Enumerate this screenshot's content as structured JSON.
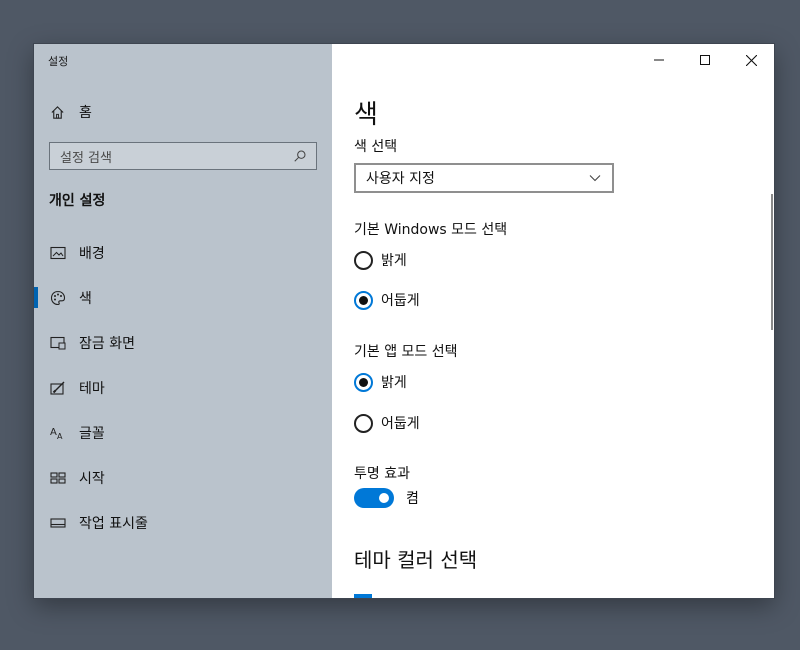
{
  "window": {
    "title": "설정"
  },
  "sidebar": {
    "home_label": "홈",
    "search_placeholder": "설정 검색",
    "section_title": "개인 설정",
    "items": [
      {
        "label": "배경",
        "icon": "picture-icon",
        "active": false
      },
      {
        "label": "색",
        "icon": "palette-icon",
        "active": true
      },
      {
        "label": "잠금 화면",
        "icon": "lock-screen-icon",
        "active": false
      },
      {
        "label": "테마",
        "icon": "theme-icon",
        "active": false
      },
      {
        "label": "글꼴",
        "icon": "font-icon",
        "active": false
      },
      {
        "label": "시작",
        "icon": "start-icon",
        "active": false
      },
      {
        "label": "작업 표시줄",
        "icon": "taskbar-icon",
        "active": false
      }
    ]
  },
  "main": {
    "page_title": "색",
    "color_select_label": "색 선택",
    "color_select_value": "사용자 지정",
    "windows_mode_label": "기본 Windows 모드 선택",
    "windows_mode_options": [
      {
        "label": "밝게",
        "selected": false
      },
      {
        "label": "어둡게",
        "selected": true
      }
    ],
    "app_mode_label": "기본 앱 모드 선택",
    "app_mode_options": [
      {
        "label": "밝게",
        "selected": true
      },
      {
        "label": "어둡게",
        "selected": false
      }
    ],
    "transparency_label": "투명 효과",
    "transparency_state": "켬",
    "transparency_on": true,
    "accent_heading": "테마 컬러 선택"
  },
  "colors": {
    "accent": "#0078d7",
    "sidebar_bg": "#bac3cc",
    "desktop_bg": "#4f5865",
    "nav_indicator": "#0063b1"
  }
}
